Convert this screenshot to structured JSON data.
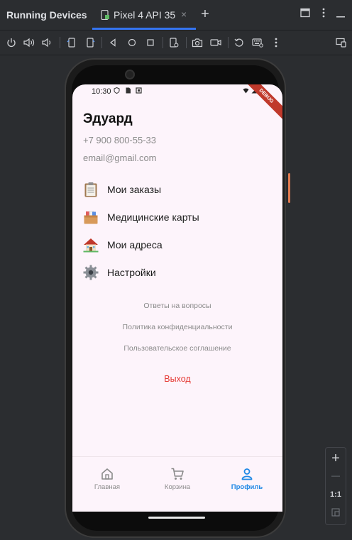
{
  "header": {
    "title": "Running Devices",
    "tab_label": "Pixel 4 API 35",
    "tab_close": "×",
    "add_tab": "+"
  },
  "toolbar": {
    "icons": [
      "power-icon",
      "volume-up-icon",
      "volume-down-icon",
      "rotate-left-icon",
      "rotate-right-icon",
      "back-icon",
      "home-icon",
      "overview-icon",
      "device-settings-icon",
      "screenshot-icon",
      "screen-record-icon",
      "reset-icon",
      "keyboard-icon",
      "more-icon",
      "device-mirroring-icon"
    ]
  },
  "status_bar": {
    "time": "10:30",
    "debug": "DEBUG"
  },
  "profile": {
    "name": "Эдуард",
    "phone": "+7 900 800-55-33",
    "email": "email@gmail.com"
  },
  "menu": [
    {
      "label": "Мои заказы",
      "icon": "clipboard-icon"
    },
    {
      "label": "Медицинские карты",
      "icon": "file-box-icon"
    },
    {
      "label": "Мои адреса",
      "icon": "house-icon"
    },
    {
      "label": "Настройки",
      "icon": "gear-icon"
    }
  ],
  "links": [
    "Ответы на вопросы",
    "Политика конфиденциальности",
    "Пользовательское соглашение"
  ],
  "logout": "Выход",
  "bottom_nav": [
    {
      "label": "Главная",
      "icon": "home-icon",
      "active": false
    },
    {
      "label": "Корзина",
      "icon": "cart-icon",
      "active": false
    },
    {
      "label": "Профиль",
      "icon": "person-icon",
      "active": true
    }
  ],
  "zoom": {
    "plus": "+",
    "minus": "—",
    "one_to_one": "1:1"
  },
  "colors": {
    "accent": "#3574f0",
    "logout": "#e53935",
    "active_nav": "#1e88e5",
    "screen_bg": "#fdf4fb"
  }
}
